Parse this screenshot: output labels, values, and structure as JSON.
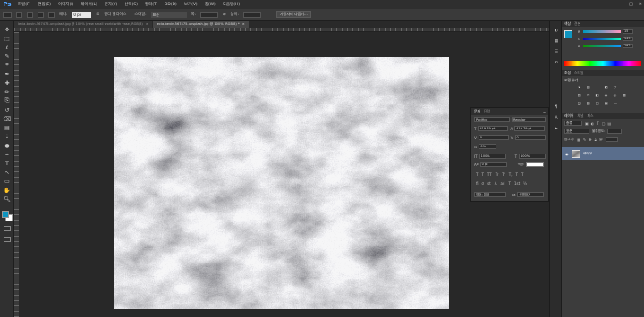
{
  "app": {
    "logo": "Ps"
  },
  "menu": [
    "파일(F)",
    "편집(E)",
    "이미지(I)",
    "레이어(L)",
    "문자(Y)",
    "선택(S)",
    "필터(T)",
    "3D(D)",
    "보기(V)",
    "창(W)",
    "도움말(H)"
  ],
  "window_controls": [
    "–",
    "□",
    "✕"
  ],
  "options_bar": {
    "feather_label": "페더:",
    "feather_value": "0 px",
    "antialias_label": "앤티 앨리어스",
    "style_label": "스타일:",
    "style_value": "표준",
    "width_label": "폭:",
    "height_label": "높이:",
    "refine_edge": "가장자리 다듬기..."
  },
  "doc_tabs": [
    {
      "name": "lecia-bevin-567475-unsplash.jpg @ 100% (new small world with vase, RGB/8)",
      "close": "×",
      "active": false
    },
    {
      "name": "lecia-bevin-567475-unsplash.jpg @ 100% (RGB/8) *",
      "close": "×",
      "active": true
    }
  ],
  "tools": [
    "move-tool",
    "marquee-tool",
    "lasso-tool",
    "quick-select-tool",
    "crop-tool",
    "eyedropper-tool",
    "healing-tool",
    "brush-tool",
    "clone-stamp-tool",
    "history-brush-tool",
    "eraser-tool",
    "gradient-tool",
    "blur-tool",
    "dodge-tool",
    "pen-tool",
    "type-tool",
    "path-select-tool",
    "shape-tool",
    "hand-tool",
    "zoom-tool"
  ],
  "char_panel": {
    "tabs": [
      "문자",
      "단락"
    ],
    "font_family": "Pacifico",
    "font_style": "Regular",
    "font_size": "419.79 pt",
    "leading": "419.79 pt",
    "kerning": "0",
    "tracking": "0",
    "vscale_pct": "0%",
    "v_scale": "100%",
    "h_scale": "100%",
    "baseline": "0 pt",
    "color_label": "색상:",
    "language": "영어: 미국",
    "aa_label": "aa",
    "aa_value": "선명하게",
    "text_style_buttons": [
      "T",
      "T",
      "TT",
      "Tr",
      "T'",
      "T,",
      "T",
      "T"
    ],
    "opentype_buttons": [
      "fi",
      "σ",
      "st",
      "A",
      "ad",
      "T",
      "1st",
      "½"
    ]
  },
  "dock_icons": [
    "color-icon",
    "swatches-icon",
    "properties-icon",
    "history-icon",
    "paragraph-icon",
    "character-icon",
    "actions-icon"
  ],
  "right_panels": {
    "color_tabs": [
      "색상",
      "견본"
    ],
    "rgb": [
      {
        "label": "R",
        "value": "15"
      },
      {
        "label": "G",
        "value": "149"
      },
      {
        "label": "B",
        "value": "192"
      }
    ],
    "adjustments_tabs": [
      "조정",
      "스타일"
    ],
    "adjustments_title": "조정 추가",
    "layers_tabs": [
      "레이어",
      "채널",
      "패스"
    ],
    "layer_kind": "종류",
    "blend_mode": "표준",
    "opacity_label": "불투명도:",
    "lock_label": "잠그기:",
    "fill_label": "칠:",
    "layer_name": "레이어"
  },
  "colors": {
    "foreground": "#0f95c0",
    "background": "#ffffff",
    "layer_selected": "#5a6e8c"
  }
}
